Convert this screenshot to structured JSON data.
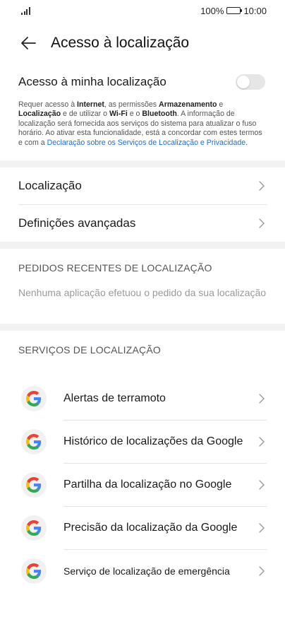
{
  "status_bar": {
    "battery_text": "100%",
    "time": "10:00"
  },
  "header": {
    "title": "Acesso à localização"
  },
  "location_toggle": {
    "label": "Acesso à minha localização",
    "state": "off"
  },
  "description": {
    "p1": "Requer acesso à ",
    "internet": "Internet",
    "p2": ", as permissões ",
    "storage": "Armazenamento",
    "p3": " e ",
    "location": "Localização",
    "p4": " e de utilizar o ",
    "wifi": "Wi-Fi",
    "p5": " e o ",
    "bluetooth": "Bluetooth",
    "p6": ". A informação de localização será fornecida aos serviços do sistema para atualizar o fuso horário. Ao ativar esta funcionalidade, está a concordar com estes termos e com a ",
    "link": "Declaração sobre os Serviços de Localização e Privacidade",
    "p7": "."
  },
  "nav": {
    "location": "Localização",
    "advanced": "Definições avançadas"
  },
  "recent_requests": {
    "header": "PEDIDOS RECENTES DE LOCALIZAÇÃO",
    "empty": "Nenhuma aplicação efetuou o pedido da sua localização"
  },
  "services": {
    "header": "SERVIÇOS DE LOCALIZAÇÃO",
    "items": [
      {
        "label": "Alertas de terramoto",
        "icon": "google-g-icon"
      },
      {
        "label": "Histórico de localizações da Google",
        "icon": "google-g-icon"
      },
      {
        "label": "Partilha da localização no Google",
        "icon": "google-g-icon"
      },
      {
        "label": "Precisão da localização da Google",
        "icon": "google-g-icon"
      },
      {
        "label": "Serviço de localização de emergência",
        "icon": "google-g-icon"
      }
    ]
  },
  "colors": {
    "link": "#1a6fe0",
    "toggle_off": "#e6e6e6",
    "google_blue": "#4285F4",
    "google_red": "#EA4335",
    "google_yellow": "#FBBC05",
    "google_green": "#34A853"
  }
}
